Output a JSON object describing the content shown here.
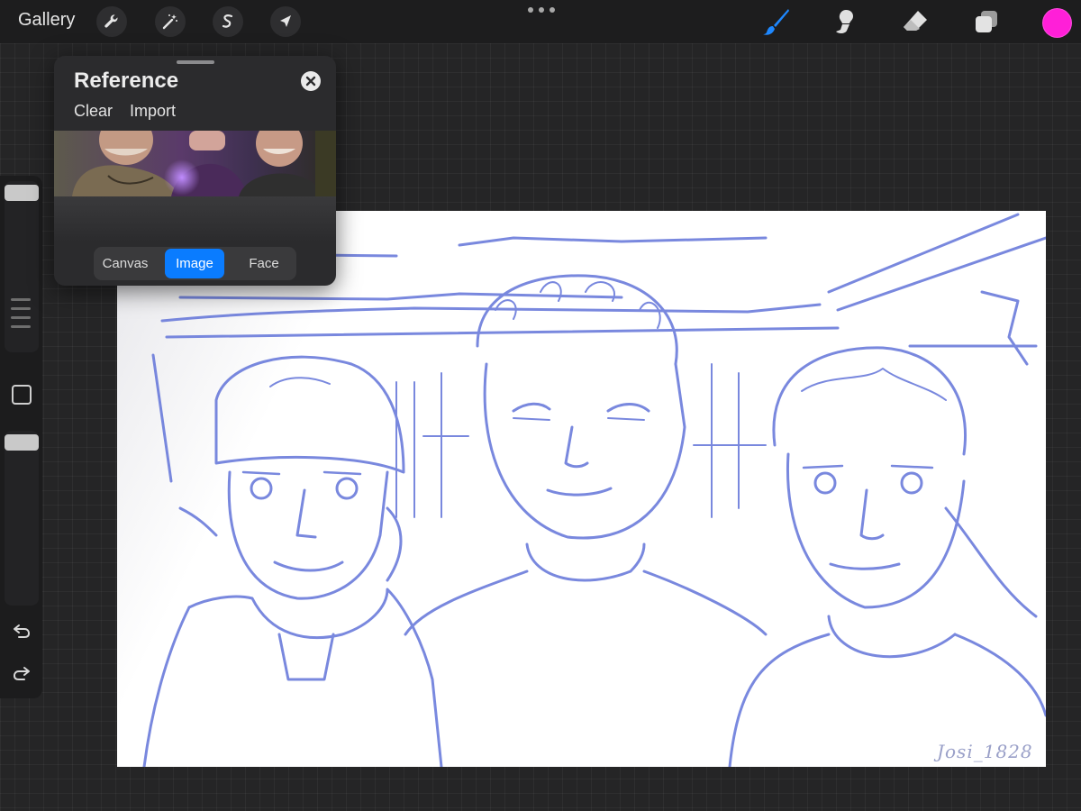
{
  "topbar": {
    "gallery_label": "Gallery",
    "left_tools": [
      {
        "name": "wrench-icon",
        "label": "Actions"
      },
      {
        "name": "magic-wand-icon",
        "label": "Adjustments"
      },
      {
        "name": "selection-icon",
        "label": "Selection"
      },
      {
        "name": "transform-arrow-icon",
        "label": "Transform"
      }
    ],
    "more_icon": "ellipsis-icon",
    "right_tools": [
      {
        "name": "brush-icon",
        "active": true
      },
      {
        "name": "smudge-icon",
        "active": false
      },
      {
        "name": "eraser-icon",
        "active": false
      },
      {
        "name": "layers-icon",
        "active": false
      }
    ],
    "current_color": "#ff1fd8"
  },
  "reference": {
    "title": "Reference",
    "clear_label": "Clear",
    "import_label": "Import",
    "tabs": [
      {
        "label": "Canvas",
        "active": false
      },
      {
        "label": "Image",
        "active": true
      },
      {
        "label": "Face",
        "active": false
      }
    ]
  },
  "sidebar": {
    "undo_icon": "undo-icon",
    "redo_icon": "redo-icon"
  },
  "canvas": {
    "signature": "Josi_1828",
    "stroke_color": "#5e6fd8"
  },
  "colors": {
    "accent": "#0a7cff",
    "toolbar_bg": "#1d1d1e"
  }
}
